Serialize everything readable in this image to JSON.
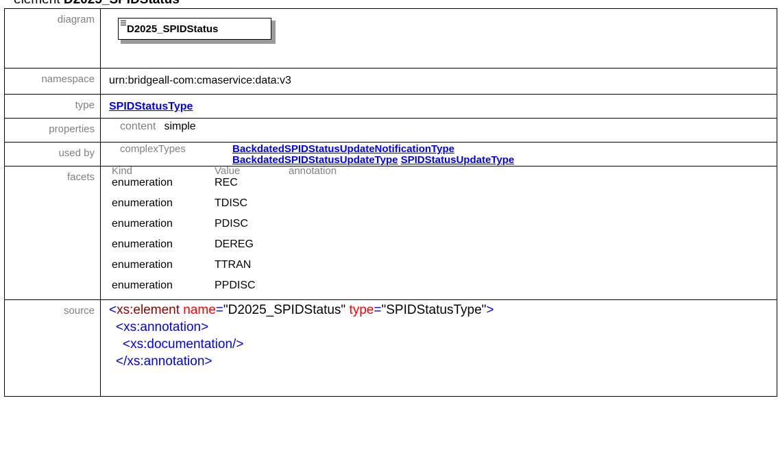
{
  "heading": {
    "prefix": "element",
    "name": "D2025_SPIDStatus"
  },
  "labels": {
    "diagram": "diagram",
    "namespace": "namespace",
    "type": "type",
    "properties": "properties",
    "used_by": "used by",
    "facets": "facets",
    "source": "source"
  },
  "diagram": {
    "box_label": "D2025_SPIDStatus"
  },
  "namespace": "urn:bridgeall-com:cmaservice:data:v3",
  "type": {
    "link": "SPIDStatusType"
  },
  "properties": {
    "key": "content",
    "value": "simple"
  },
  "used_by": {
    "kind": "complexTypes",
    "links": [
      "BackdatedSPIDStatusUpdateNotificationType",
      "BackdatedSPIDStatusUpdateType",
      "SPIDStatusUpdateType"
    ]
  },
  "facets": {
    "headers": [
      "Kind",
      "Value",
      "annotation"
    ],
    "rows": [
      {
        "kind": "enumeration",
        "value": "REC"
      },
      {
        "kind": "enumeration",
        "value": "TDISC"
      },
      {
        "kind": "enumeration",
        "value": "PDISC"
      },
      {
        "kind": "enumeration",
        "value": "DEREG"
      },
      {
        "kind": "enumeration",
        "value": "TTRAN"
      },
      {
        "kind": "enumeration",
        "value": "PPDISC"
      }
    ]
  },
  "source": {
    "line1": {
      "open": "<",
      "tag": "xs:element",
      "attr1": "name",
      "val1": "\"D2025_SPIDStatus\"",
      "attr2": "type",
      "val2": "\"SPIDStatusType\"",
      "close": ">"
    },
    "line2": "<xs:annotation>",
    "line3": "<xs:documentation/>",
    "line4": "</xs:annotation>"
  }
}
